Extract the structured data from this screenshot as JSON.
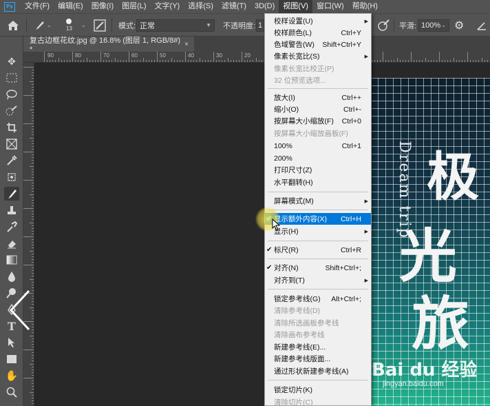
{
  "app": {
    "logo": "Ps"
  },
  "menubar": {
    "items": [
      "文件(F)",
      "编辑(E)",
      "图像(I)",
      "图层(L)",
      "文字(Y)",
      "选择(S)",
      "滤镜(T)",
      "3D(D)",
      "视图(V)",
      "窗口(W)",
      "帮助(H)"
    ]
  },
  "options": {
    "brush_size": "13",
    "mode_label": "模式:",
    "mode_value": "正常",
    "opacity_label": "不透明度:",
    "opacity_value": "1",
    "smoothing_label": "平滑:",
    "smoothing_value": "100%"
  },
  "document": {
    "tab_title": "复古边框花纹.jpg @ 16.8% (图层 1, RGB/8#) *",
    "close_glyph": "×"
  },
  "ruler": {
    "labels": [
      "90",
      "80",
      "70",
      "60",
      "50",
      "40",
      "30",
      "20",
      "10"
    ]
  },
  "poster": {
    "chars": [
      "极",
      "光",
      "旅"
    ],
    "english": "Dream trip"
  },
  "watermark": {
    "text": "Bai du 经验",
    "sub": "jingyan.baidu.com"
  },
  "view_menu": {
    "items": [
      {
        "label": "校样设置(U)",
        "shortcut": "",
        "submenu": true,
        "disabled": false
      },
      {
        "label": "校样颜色(L)",
        "shortcut": "Ctrl+Y",
        "submenu": false,
        "disabled": false
      },
      {
        "label": "色域警告(W)",
        "shortcut": "Shift+Ctrl+Y",
        "submenu": false,
        "disabled": false
      },
      {
        "label": "像素长宽比(S)",
        "shortcut": "",
        "submenu": true,
        "disabled": false
      },
      {
        "label": "像素长宽比校正(P)",
        "shortcut": "",
        "submenu": false,
        "disabled": true
      },
      {
        "label": "32 位预览选项...",
        "shortcut": "",
        "submenu": false,
        "disabled": true
      },
      {
        "label": "放大(I)",
        "shortcut": "Ctrl++",
        "submenu": false,
        "disabled": false
      },
      {
        "label": "缩小(O)",
        "shortcut": "Ctrl+-",
        "submenu": false,
        "disabled": false
      },
      {
        "label": "按屏幕大小缩放(F)",
        "shortcut": "Ctrl+0",
        "submenu": false,
        "disabled": false
      },
      {
        "label": "按屏幕大小缩放画板(F)",
        "shortcut": "",
        "submenu": false,
        "disabled": true
      },
      {
        "label": "100%",
        "shortcut": "Ctrl+1",
        "submenu": false,
        "disabled": false
      },
      {
        "label": "200%",
        "shortcut": "",
        "submenu": false,
        "disabled": false
      },
      {
        "label": "打印尺寸(Z)",
        "shortcut": "",
        "submenu": false,
        "disabled": false
      },
      {
        "label": "水平翻转(H)",
        "shortcut": "",
        "submenu": false,
        "disabled": false
      },
      {
        "label": "屏幕模式(M)",
        "shortcut": "",
        "submenu": true,
        "disabled": false
      },
      {
        "label": "显示额外内容(X)",
        "shortcut": "Ctrl+H",
        "submenu": false,
        "disabled": false,
        "checked": true,
        "highlighted": true
      },
      {
        "label": "显示(H)",
        "shortcut": "",
        "submenu": true,
        "disabled": false
      },
      {
        "label": "标尺(R)",
        "shortcut": "Ctrl+R",
        "submenu": false,
        "disabled": false,
        "checked": true
      },
      {
        "label": "对齐(N)",
        "shortcut": "Shift+Ctrl+;",
        "submenu": false,
        "disabled": false,
        "checked": true
      },
      {
        "label": "对齐到(T)",
        "shortcut": "",
        "submenu": true,
        "disabled": false
      },
      {
        "label": "锁定参考线(G)",
        "shortcut": "Alt+Ctrl+;",
        "submenu": false,
        "disabled": false
      },
      {
        "label": "清除参考线(D)",
        "shortcut": "",
        "submenu": false,
        "disabled": true
      },
      {
        "label": "清除所选画板参考线",
        "shortcut": "",
        "submenu": false,
        "disabled": true
      },
      {
        "label": "清除画布参考线",
        "shortcut": "",
        "submenu": false,
        "disabled": true
      },
      {
        "label": "新建参考线(E)...",
        "shortcut": "",
        "submenu": false,
        "disabled": false
      },
      {
        "label": "新建参考线版面...",
        "shortcut": "",
        "submenu": false,
        "disabled": false
      },
      {
        "label": "通过形状新建参考线(A)",
        "shortcut": "",
        "submenu": false,
        "disabled": false
      },
      {
        "label": "锁定切片(K)",
        "shortcut": "",
        "submenu": false,
        "disabled": false
      },
      {
        "label": "清除切片(C)",
        "shortcut": "",
        "submenu": false,
        "disabled": true
      }
    ],
    "check_glyph": "✔",
    "arrow_glyph": "▶"
  },
  "colors": {
    "highlight": "#0078d7",
    "menu_bg": "#f0f0f0",
    "ui_bg": "#535353",
    "accent": "#31a8ff"
  }
}
